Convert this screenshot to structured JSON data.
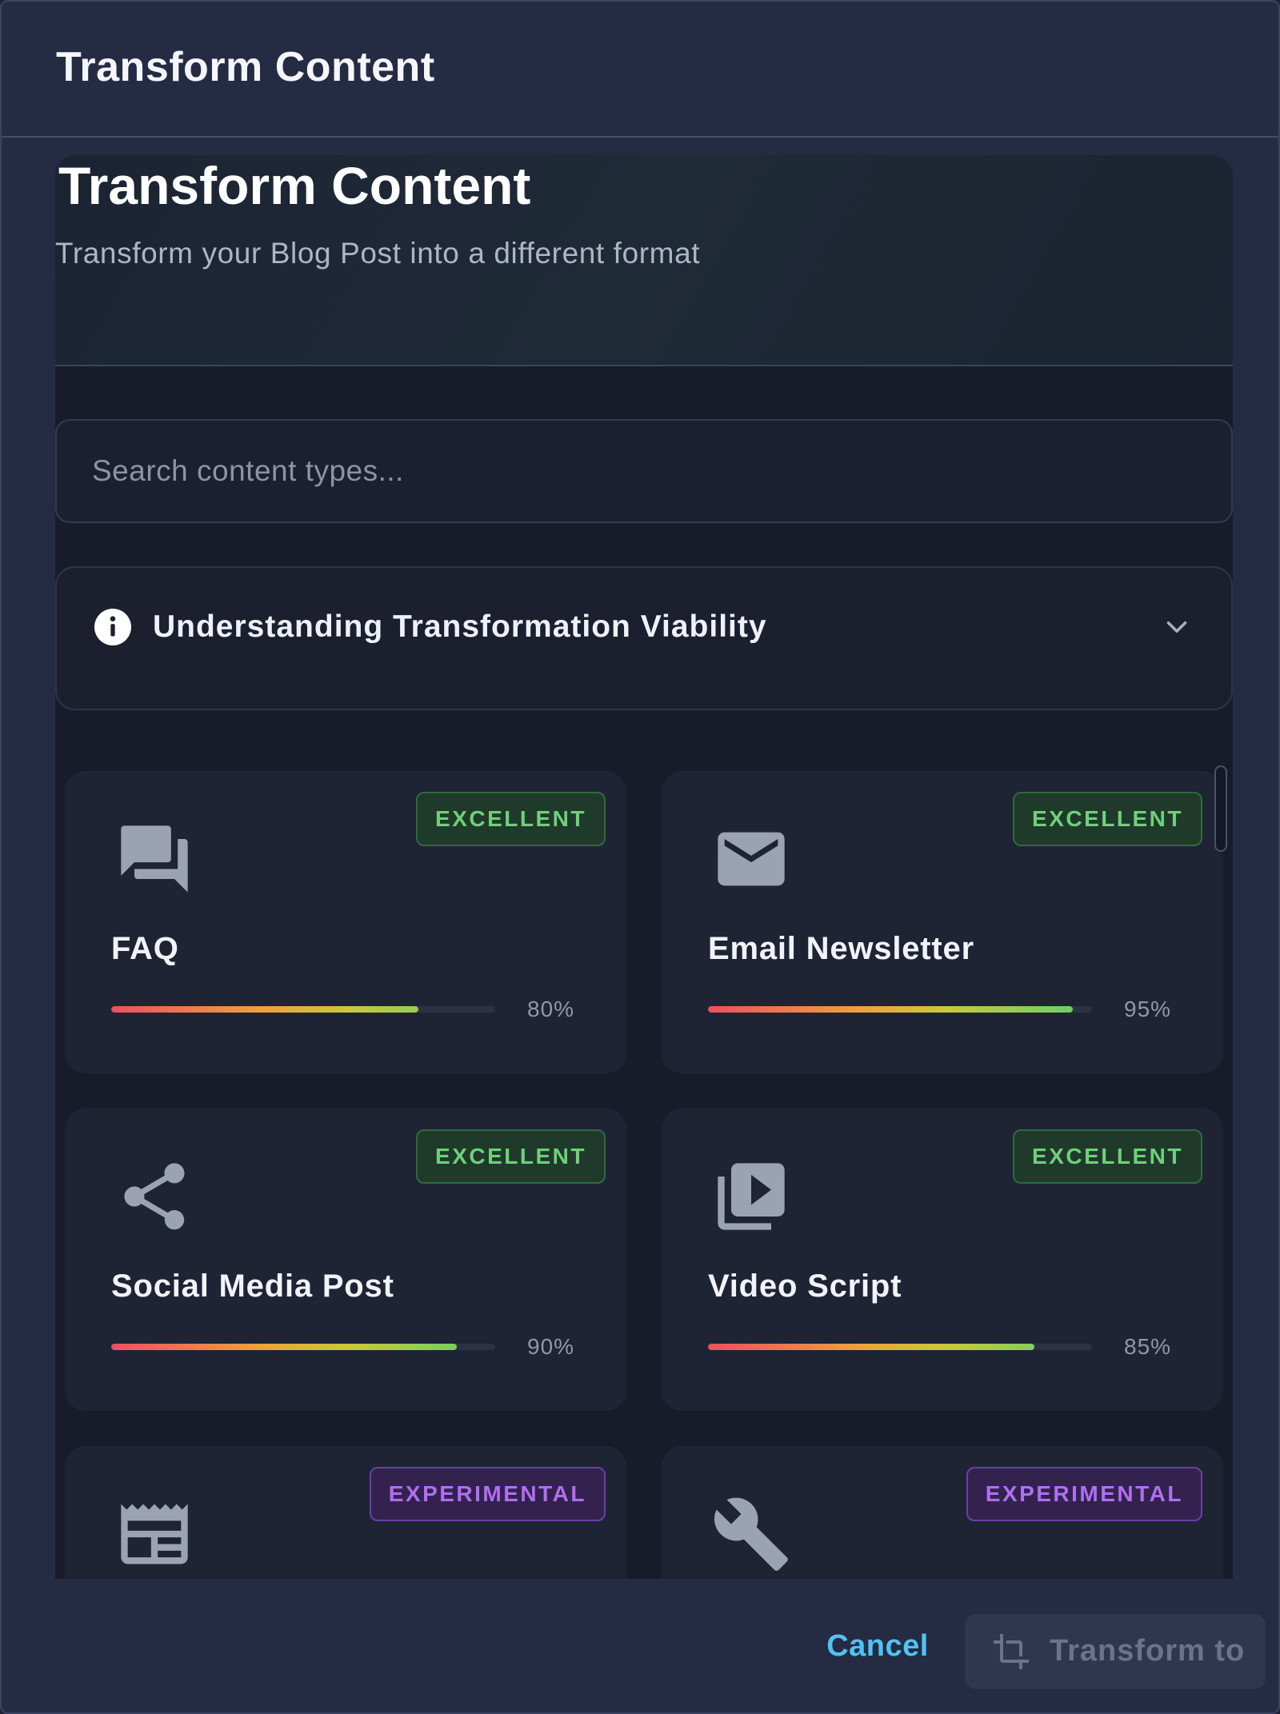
{
  "dialog": {
    "title": "Transform Content"
  },
  "hero": {
    "title": "Transform Content",
    "subtitle": "Transform your Blog Post into a different format"
  },
  "search": {
    "placeholder": "Search content types..."
  },
  "accordion": {
    "label": "Understanding Transformation Viability",
    "expanded": false
  },
  "cards": [
    {
      "title": "FAQ",
      "badge": "EXCELLENT",
      "badge_kind": "excellent",
      "icon": "forum-icon",
      "viability": 80,
      "percent_label": "80%"
    },
    {
      "title": "Email Newsletter",
      "badge": "EXCELLENT",
      "badge_kind": "excellent",
      "icon": "email-icon",
      "viability": 95,
      "percent_label": "95%"
    },
    {
      "title": "Social Media Post",
      "badge": "EXCELLENT",
      "badge_kind": "excellent",
      "icon": "share-icon",
      "viability": 90,
      "percent_label": "90%"
    },
    {
      "title": "Video Script",
      "badge": "EXCELLENT",
      "badge_kind": "excellent",
      "icon": "video-library-icon",
      "viability": 85,
      "percent_label": "85%"
    },
    {
      "title": "",
      "badge": "EXPERIMENTAL",
      "badge_kind": "experimental",
      "icon": "newspaper-icon",
      "viability": null,
      "percent_label": ""
    },
    {
      "title": "",
      "badge": "EXPERIMENTAL",
      "badge_kind": "experimental",
      "icon": "wrench-icon",
      "viability": null,
      "percent_label": ""
    }
  ],
  "footer": {
    "cancel_label": "Cancel",
    "transform_label": "Transform to"
  },
  "colors": {
    "accent": "#4fc3f7",
    "excellent": "#6fd07a",
    "experimental": "#b06ef0",
    "icon": "#9aa2b4"
  }
}
